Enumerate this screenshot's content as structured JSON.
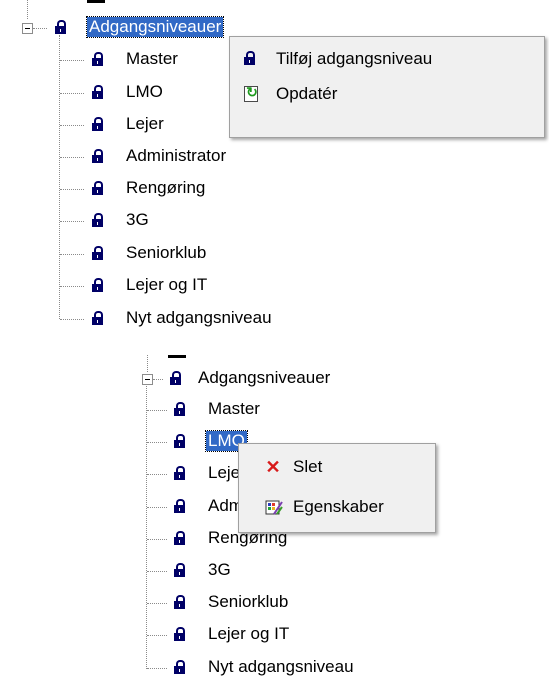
{
  "top_tree": {
    "root_label": "Adgangsniveauer",
    "items": [
      "Master",
      "LMO",
      "Lejer",
      "Administrator",
      "Rengøring",
      "3G",
      "Seniorklub",
      "Lejer og IT",
      "Nyt adgangsniveau"
    ]
  },
  "top_menu": {
    "items": [
      {
        "label": "Tilføj adgangsniveau",
        "icon": "lock-icon"
      },
      {
        "label": "Opdatér",
        "icon": "refresh-icon"
      }
    ]
  },
  "bottom_tree": {
    "root_label": "Adgangsniveauer",
    "items": [
      "Master",
      "LMO",
      "Lejer",
      "Administrator",
      "Rengøring",
      "3G",
      "Seniorklub",
      "Lejer og IT",
      "Nyt adgangsniveau"
    ]
  },
  "bottom_menu": {
    "items": [
      {
        "label": "Slet",
        "icon": "delete-icon",
        "color": "#d81a1a"
      },
      {
        "label": "Egenskaber",
        "icon": "properties-icon"
      }
    ]
  },
  "colors": {
    "selection": "#3169c6",
    "lock": "#000066",
    "menu_background": "#f0f0f0"
  }
}
